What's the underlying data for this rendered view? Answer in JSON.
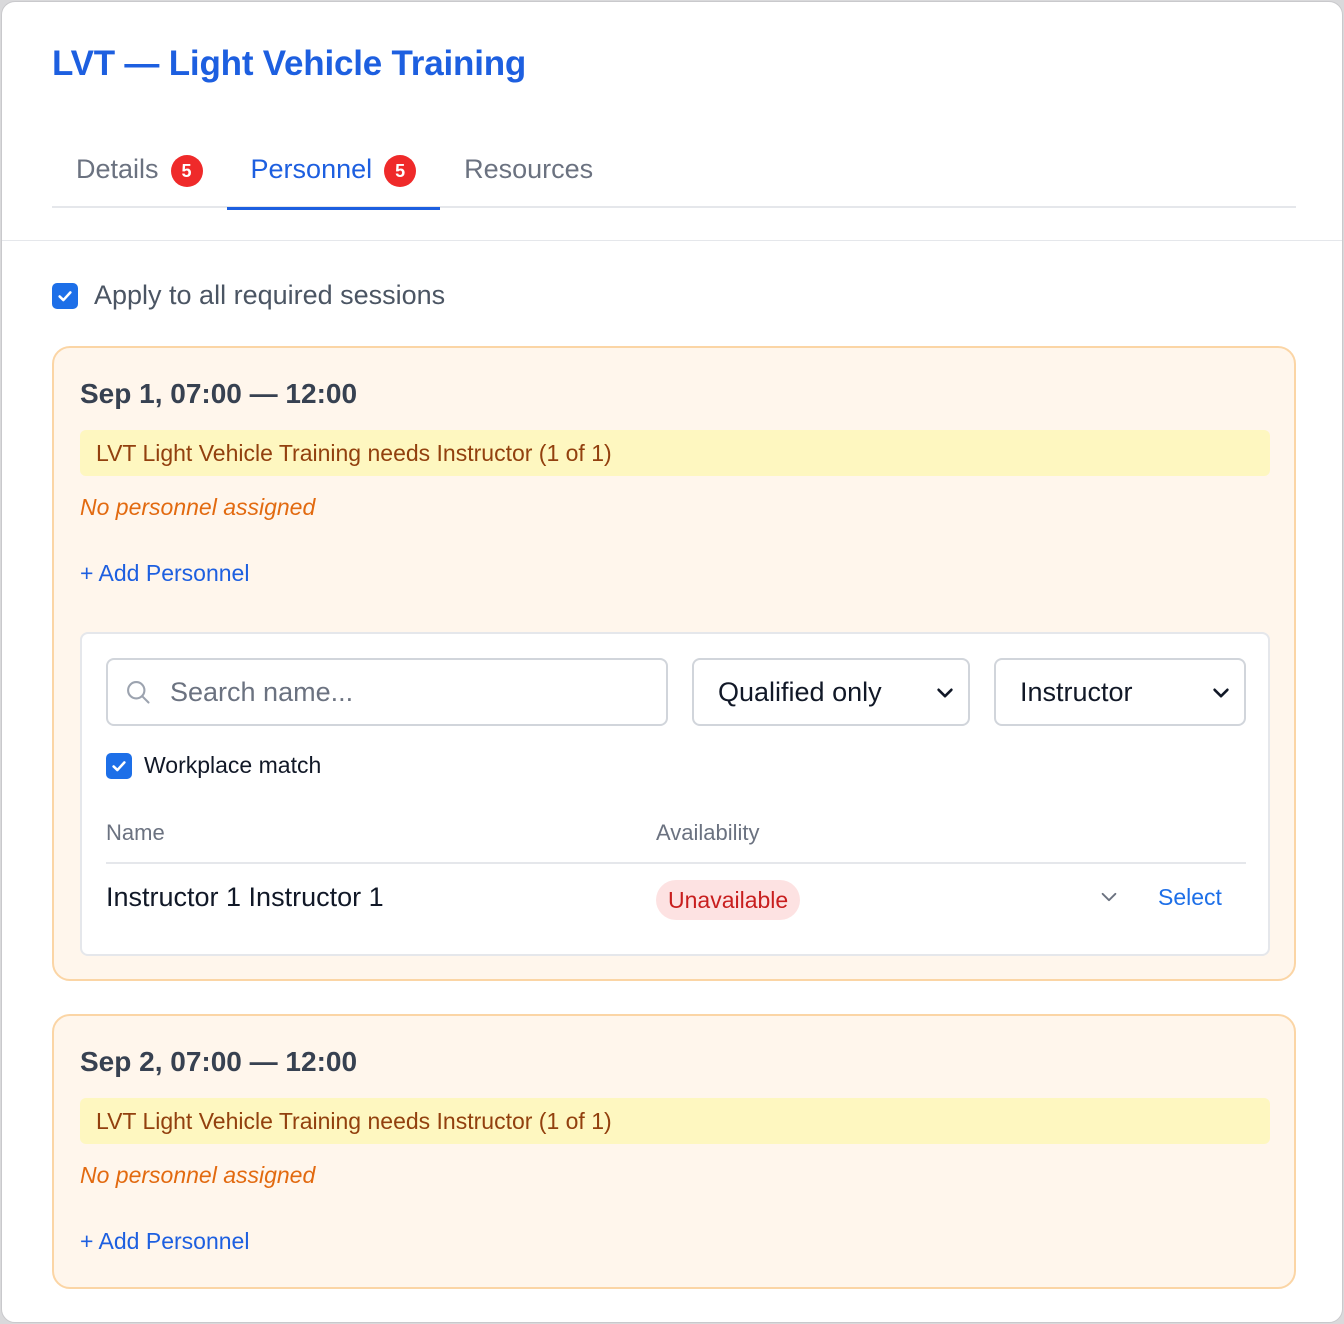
{
  "title": "LVT — Light Vehicle Training",
  "tabs": [
    {
      "label": "Details",
      "badge": "5"
    },
    {
      "label": "Personnel",
      "badge": "5"
    },
    {
      "label": "Resources"
    }
  ],
  "apply_all_label": "Apply to all required sessions",
  "sessions": [
    {
      "time": "Sep 1, 07:00 — 12:00",
      "needs": "LVT Light Vehicle Training needs Instructor (1 of 1)",
      "empty": "No personnel assigned",
      "add_label": "+ Add Personnel",
      "picker": {
        "search_placeholder": "Search name...",
        "filter_qualification": "Qualified only",
        "filter_role": "Instructor",
        "workplace_label": "Workplace match",
        "columns": [
          "Name",
          "Availability"
        ],
        "rows": [
          {
            "name": "Instructor 1 Instructor 1",
            "availability": "Unavailable",
            "action": "Select"
          }
        ]
      }
    },
    {
      "time": "Sep 2, 07:00 — 12:00",
      "needs": "LVT Light Vehicle Training needs Instructor (1 of 1)",
      "empty": "No personnel assigned",
      "add_label": "+ Add Personnel"
    }
  ],
  "colors": {
    "accent": "#1d5fe0",
    "badge": "#ef2a2a",
    "session_bg": "#fff6ec",
    "session_border": "#fbd5a5",
    "needs_bg": "#fef7c0",
    "warning_text": "#e26a10",
    "unavailable_bg": "#fde2e2",
    "unavailable_text": "#c81e1e"
  },
  "icons": {
    "checkbox": "check-icon",
    "search": "search-icon",
    "dropdown": "chevron-down-icon"
  }
}
